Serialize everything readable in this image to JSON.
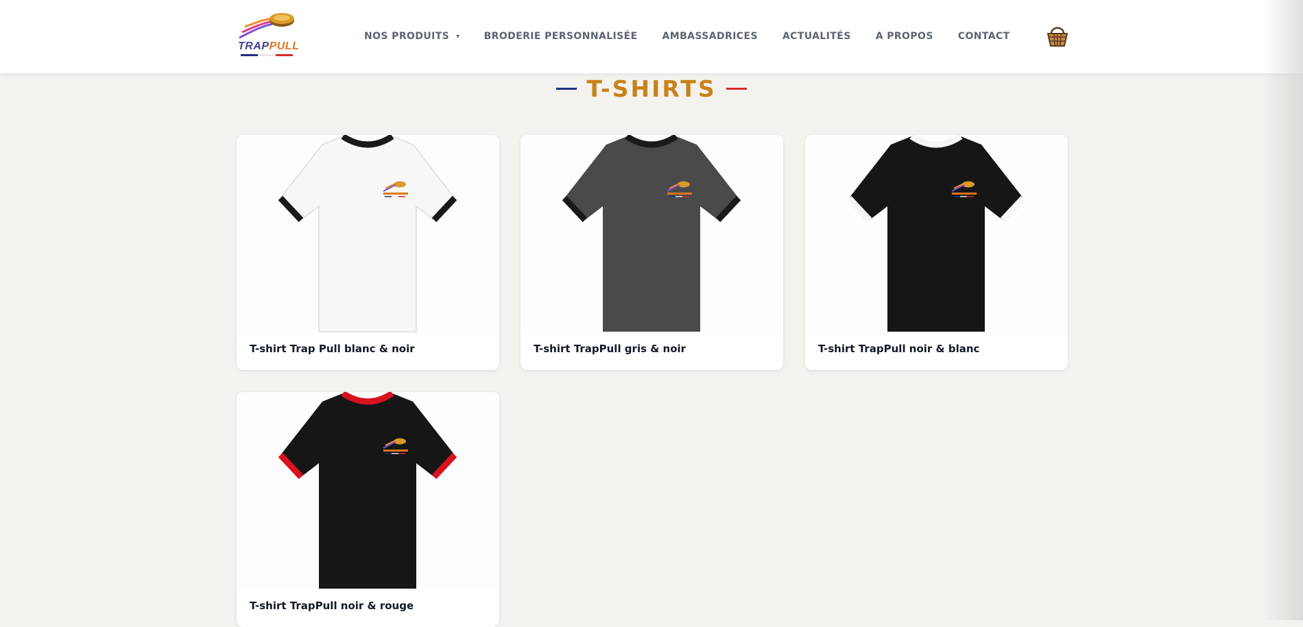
{
  "brand": {
    "logo_text_part1": "TRAP",
    "logo_text_part2": "PULL",
    "icon": "puck-logo-icon"
  },
  "nav": {
    "items": [
      {
        "label": "NOS PRODUITS",
        "has_dropdown": true
      },
      {
        "label": "BRODERIE PERSONNALISÉE"
      },
      {
        "label": "AMBASSADRICES"
      },
      {
        "label": "ACTUALITÉS"
      },
      {
        "label": "A PROPOS"
      },
      {
        "label": "CONTACT"
      }
    ],
    "dropdown_caret": "⌄",
    "cart_icon": "basket-icon"
  },
  "section": {
    "title": "T-SHIRTS",
    "dash_left_color": "#1f2f86",
    "dash_right_color": "#d62a2a"
  },
  "products": [
    {
      "title": "T-shirt Trap Pull blanc & noir",
      "body_color": "#f7f7f7",
      "trim_color": "#1a1a1a"
    },
    {
      "title": "T-shirt TrapPull gris & noir",
      "body_color": "#4a4a4c",
      "trim_color": "#1a1a1a"
    },
    {
      "title": "T-shirt TrapPull noir & blanc",
      "body_color": "#161616",
      "trim_color": "#f5f5f5"
    },
    {
      "title": "T-shirt TrapPull noir & rouge",
      "body_color": "#161616",
      "trim_color": "#d8121e"
    }
  ],
  "colors": {
    "accent_gold": "#c7821a",
    "nav_text": "#5c6474",
    "background": "#f3f2ef"
  }
}
